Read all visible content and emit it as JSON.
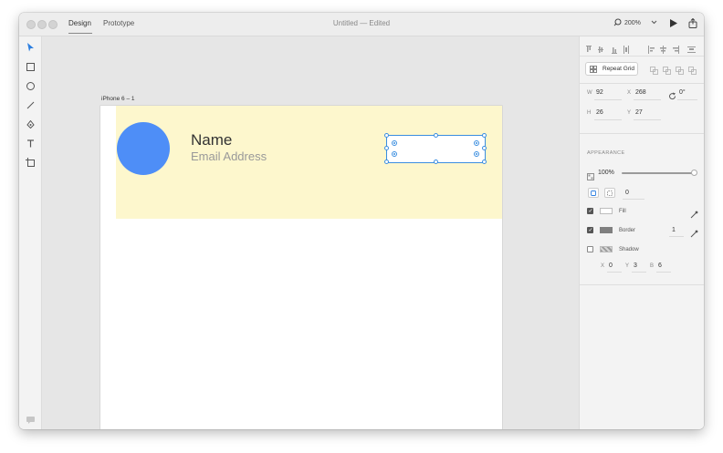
{
  "titlebar": {
    "tabs": [
      {
        "label": "Design",
        "active": true
      },
      {
        "label": "Prototype",
        "active": false
      }
    ],
    "title": "Untitled — Edited",
    "zoom": "200%",
    "search_icon": "search-icon",
    "play_icon": "play-icon",
    "share_icon": "share-icon"
  },
  "tools": [
    "select-arrow-icon",
    "rectangle-icon",
    "ellipse-icon",
    "line-icon",
    "pen-icon",
    "text-icon",
    "artboard-icon"
  ],
  "canvas": {
    "artboard_label": "iPhone 6 – 1",
    "card": {
      "name": "Name",
      "email": "Email Address",
      "bg_color": "#fdf7cd",
      "avatar_color": "#4e8ef7"
    }
  },
  "panel": {
    "repeat_grid": "Repeat Grid",
    "props": {
      "w_label": "W",
      "w": "92",
      "x_label": "X",
      "x": "268",
      "rotation": "0°",
      "h_label": "H",
      "h": "26",
      "y_label": "Y",
      "y": "27"
    },
    "appearance": {
      "heading": "APPEARANCE",
      "opacity": "100%",
      "opacity_fraction": 1.0,
      "corner_radius": "0",
      "fill_label": "Fill",
      "fill_checked": true,
      "fill_color": "#ffffff",
      "border_label": "Border",
      "border_checked": true,
      "border_color": "#808080",
      "border_width": "1",
      "shadow_label": "Shadow",
      "shadow_checked": false,
      "shadow_x_label": "X",
      "shadow_x": "0",
      "shadow_y_label": "Y",
      "shadow_y": "3",
      "shadow_b_label": "B",
      "shadow_b": "6"
    }
  }
}
